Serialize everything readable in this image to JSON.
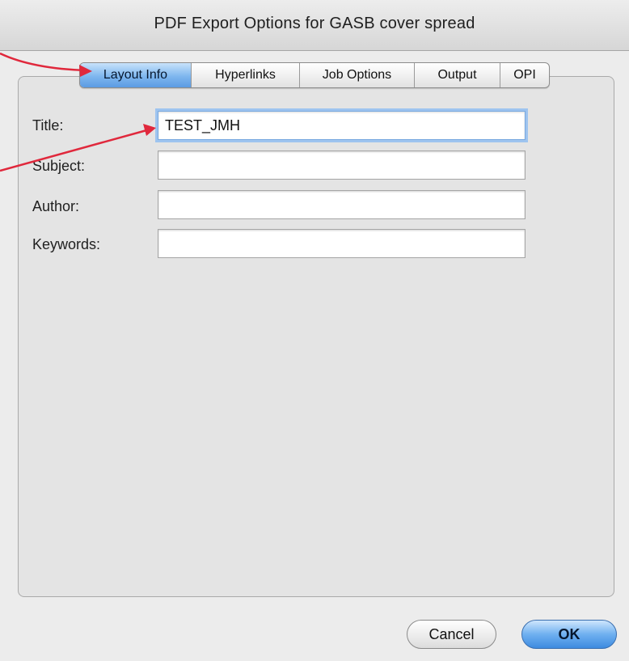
{
  "window": {
    "title": "PDF Export Options for GASB cover spread"
  },
  "tabs": [
    {
      "label": "Layout Info",
      "active": true
    },
    {
      "label": "Hyperlinks",
      "active": false
    },
    {
      "label": "Job Options",
      "active": false
    },
    {
      "label": "Output",
      "active": false
    },
    {
      "label": "OPI",
      "active": false
    }
  ],
  "form": {
    "title_label": "Title:",
    "title_value": "TEST_JMH",
    "subject_label": "Subject:",
    "subject_value": "",
    "author_label": "Author:",
    "author_value": "",
    "keywords_label": "Keywords:",
    "keywords_value": ""
  },
  "buttons": {
    "cancel_label": "Cancel",
    "ok_label": "OK"
  },
  "colors": {
    "accent_blue": "#5b9be3",
    "annotation_red": "#e0283c"
  }
}
